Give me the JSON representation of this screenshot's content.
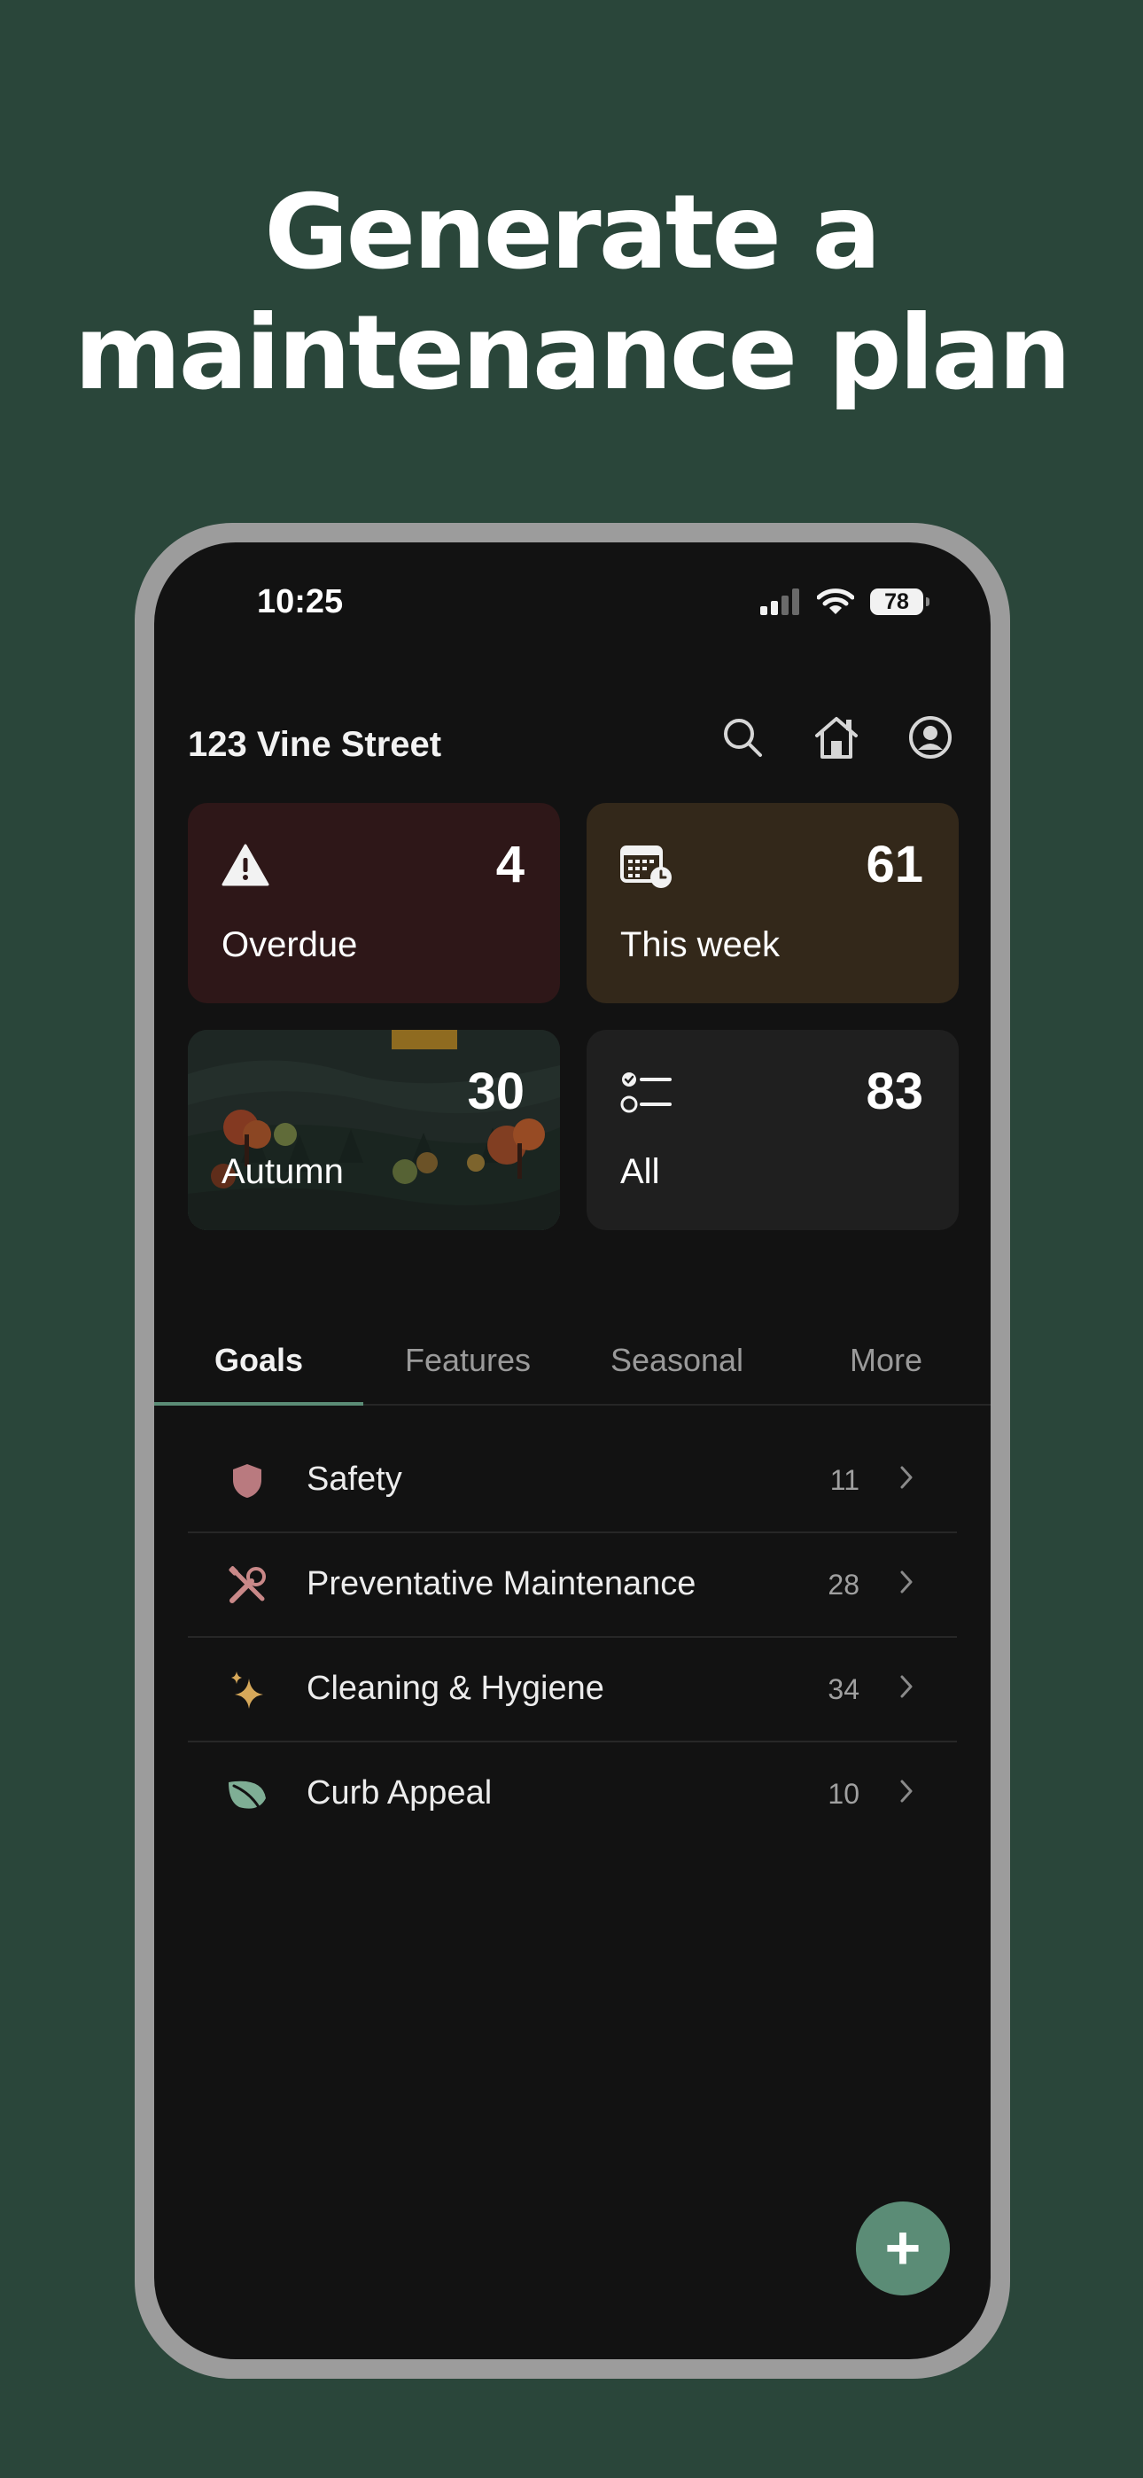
{
  "headline": {
    "line1": "Generate a",
    "line2": "maintenance plan"
  },
  "status_bar": {
    "time": "10:25",
    "battery": "78"
  },
  "header": {
    "address": "123 Vine Street",
    "icons": [
      "search-icon",
      "home-icon",
      "profile-icon"
    ]
  },
  "cards": {
    "overdue": {
      "count": "4",
      "label": "Overdue",
      "icon": "warning-icon",
      "color": "#2e1718"
    },
    "this_week": {
      "count": "61",
      "label": "This week",
      "icon": "calendar-clock-icon",
      "color": "#33281a"
    },
    "autumn": {
      "count": "30",
      "label": "Autumn",
      "icon": "autumn-landscape-image"
    },
    "all": {
      "count": "83",
      "label": "All",
      "icon": "checklist-icon",
      "color": "#1f1f1f"
    }
  },
  "tabs": [
    {
      "label": "Goals",
      "active": true
    },
    {
      "label": "Features",
      "active": false
    },
    {
      "label": "Seasonal",
      "active": false
    },
    {
      "label": "More",
      "active": false
    }
  ],
  "goals": [
    {
      "label": "Safety",
      "count": "11",
      "icon": "shield-icon",
      "color": "#b97a7f"
    },
    {
      "label": "Preventative Maintenance",
      "count": "28",
      "icon": "tools-icon",
      "color": "#c98888"
    },
    {
      "label": "Cleaning & Hygiene",
      "count": "34",
      "icon": "sparkle-icon",
      "color": "#d6a85a"
    },
    {
      "label": "Curb Appeal",
      "count": "10",
      "icon": "leaf-icon",
      "color": "#7fae95"
    }
  ],
  "fab": {
    "label": "+",
    "color": "#5b8c76"
  },
  "colors": {
    "background": "#2a463a",
    "screen": "#121212",
    "accent": "#5b8c76"
  }
}
